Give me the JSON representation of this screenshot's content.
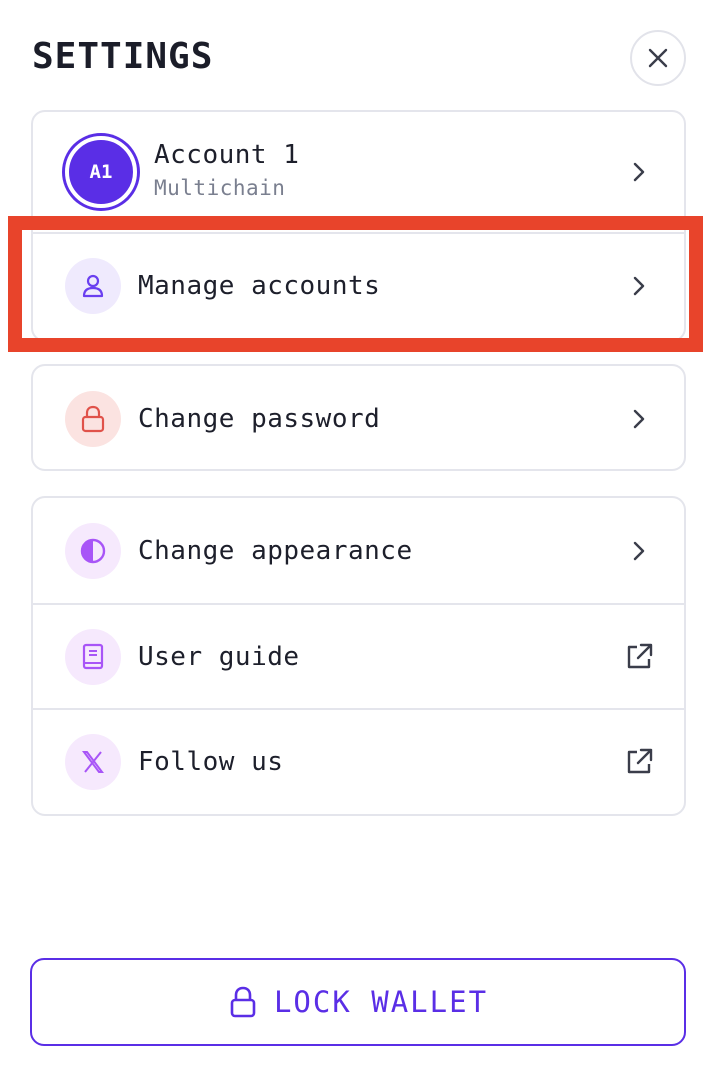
{
  "header": {
    "title": "SETTINGS",
    "close_icon": "close-icon"
  },
  "account": {
    "avatar_initials": "A1",
    "name": "Account 1",
    "subtitle": "Multichain",
    "avatar_color": "#5a2ee6"
  },
  "menu": {
    "manage_accounts": "Manage accounts",
    "change_password": "Change password",
    "change_appearance": "Change appearance",
    "user_guide": "User guide",
    "follow_us": "Follow us"
  },
  "footer": {
    "lock_label": "LOCK WALLET"
  },
  "colors": {
    "accent": "#5a2ee6",
    "highlight": "#e8442b",
    "password_icon": "#e0524a",
    "purple_icon": "#a855f7"
  }
}
